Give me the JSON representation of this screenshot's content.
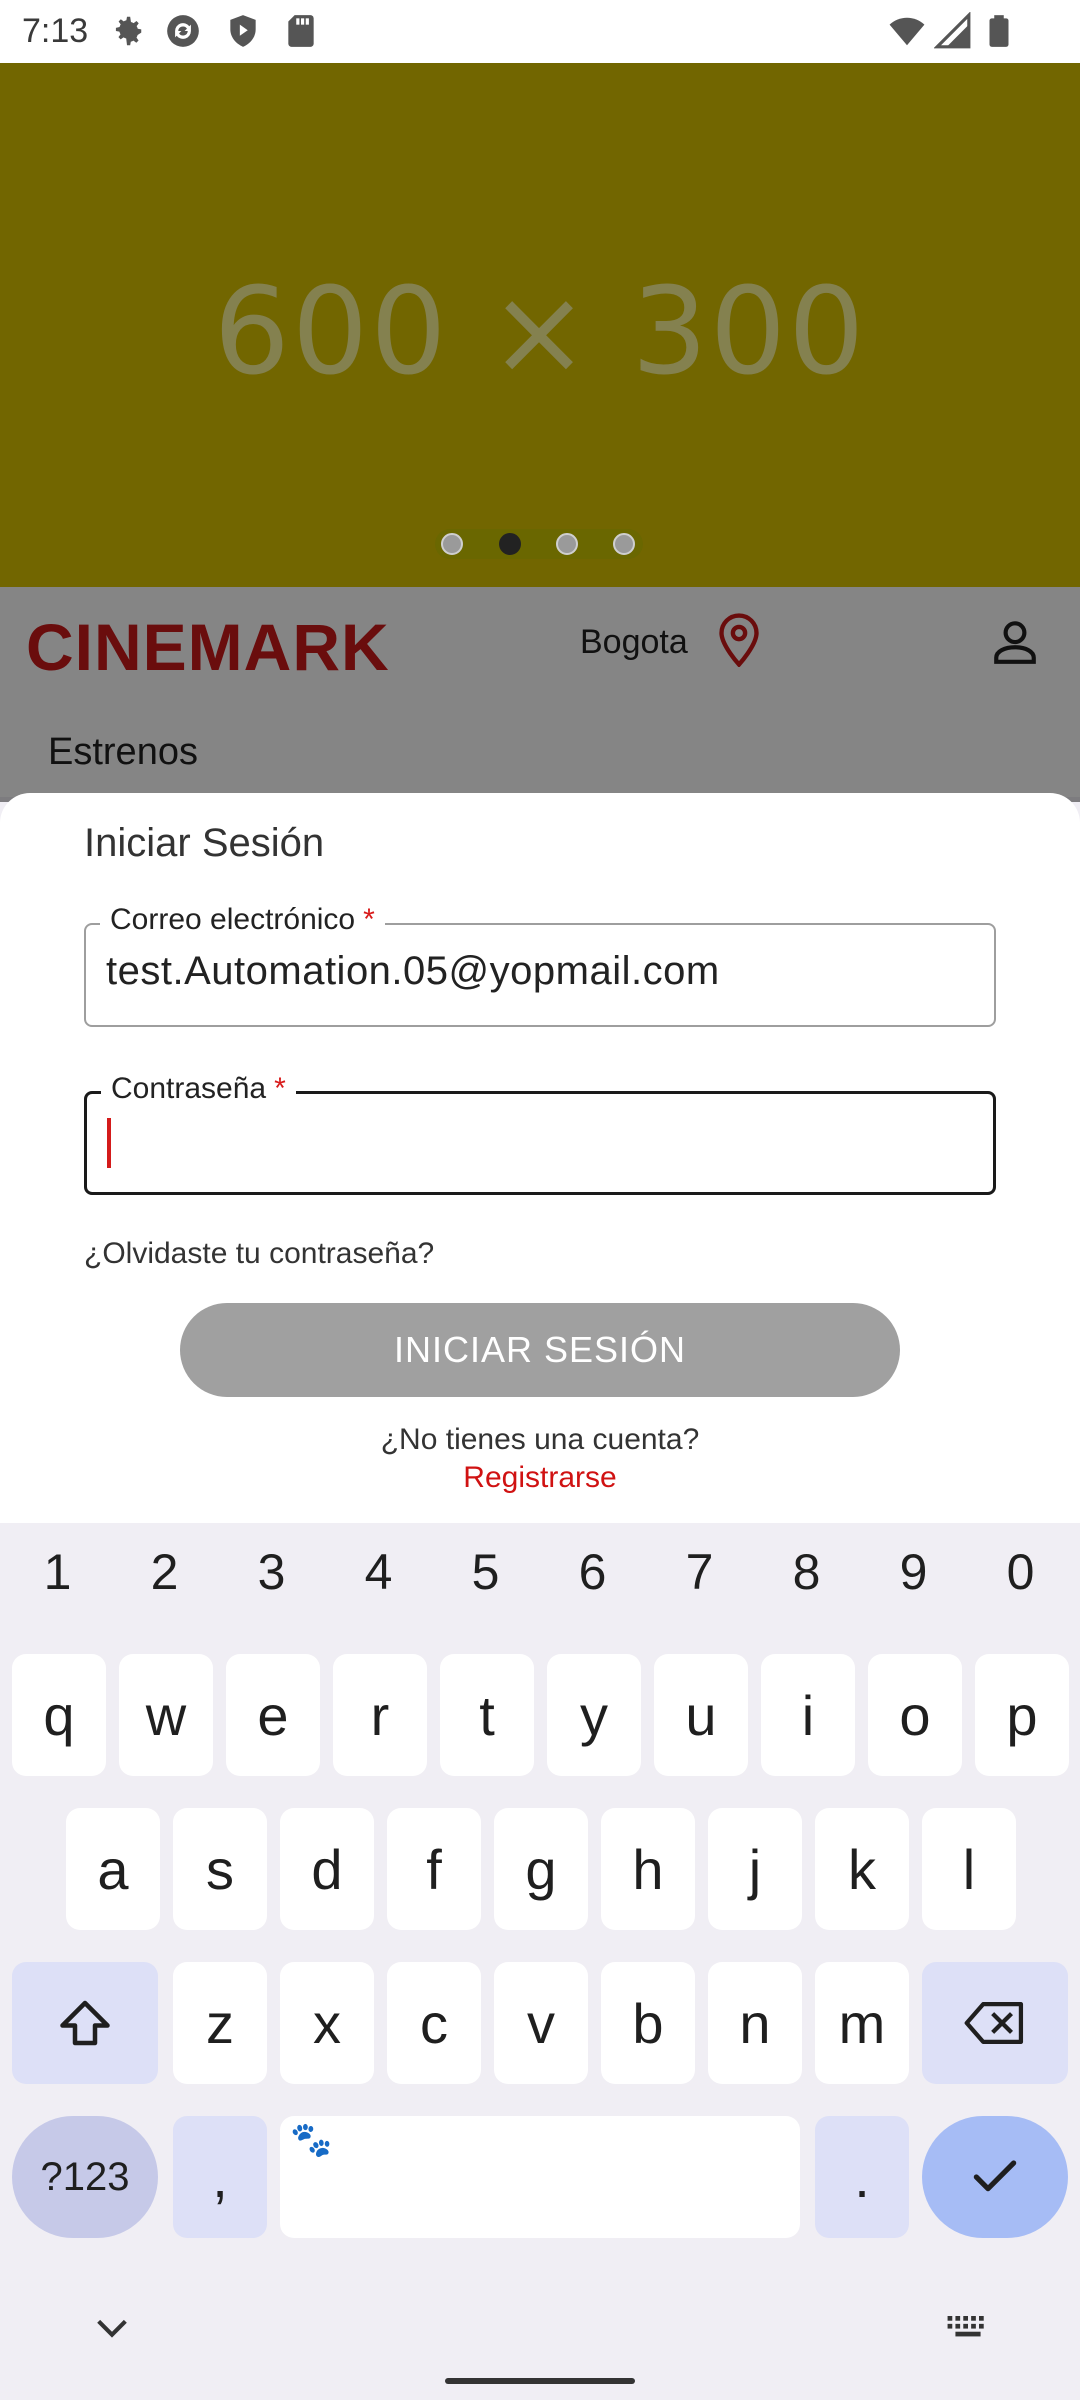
{
  "status_bar": {
    "time": "7:13",
    "icons": [
      "gear-icon",
      "sync-icon",
      "shield-play-icon",
      "sd-card-icon",
      "wifi-icon",
      "signal-icon",
      "battery-icon"
    ]
  },
  "banner": {
    "placeholder_text": "600 × 300",
    "carousel": {
      "count": 4,
      "active_index": 1
    }
  },
  "header": {
    "brand": "CINEMARK",
    "city": "Bogota",
    "section_title": "Estrenos"
  },
  "login": {
    "title": "Iniciar Sesión",
    "email": {
      "label": "Correo electrónico",
      "required_mark": "*",
      "value": "test.Automation.05@yopmail.com"
    },
    "password": {
      "label": "Contraseña",
      "required_mark": "*",
      "value": ""
    },
    "forgot_link": "¿Olvidaste tu contraseña?",
    "submit_label": "INICIAR SESIÓN",
    "no_account_text": "¿No tienes una cuenta?",
    "register_link": "Registrarse"
  },
  "keyboard": {
    "numbers": [
      "1",
      "2",
      "3",
      "4",
      "5",
      "6",
      "7",
      "8",
      "9",
      "0"
    ],
    "row1": [
      "q",
      "w",
      "e",
      "r",
      "t",
      "y",
      "u",
      "i",
      "o",
      "p"
    ],
    "row2": [
      "a",
      "s",
      "d",
      "f",
      "g",
      "h",
      "j",
      "k",
      "l"
    ],
    "row3": [
      "z",
      "x",
      "c",
      "v",
      "b",
      "n",
      "m"
    ],
    "symbols_key": "?123",
    "comma_key": ",",
    "period_key": "."
  },
  "colors": {
    "brand_red": "#cc1a1a",
    "banner": "#726600",
    "link_red": "#d01212",
    "button_disabled": "#a0a0a0",
    "enter_key": "#a6bcf5"
  }
}
